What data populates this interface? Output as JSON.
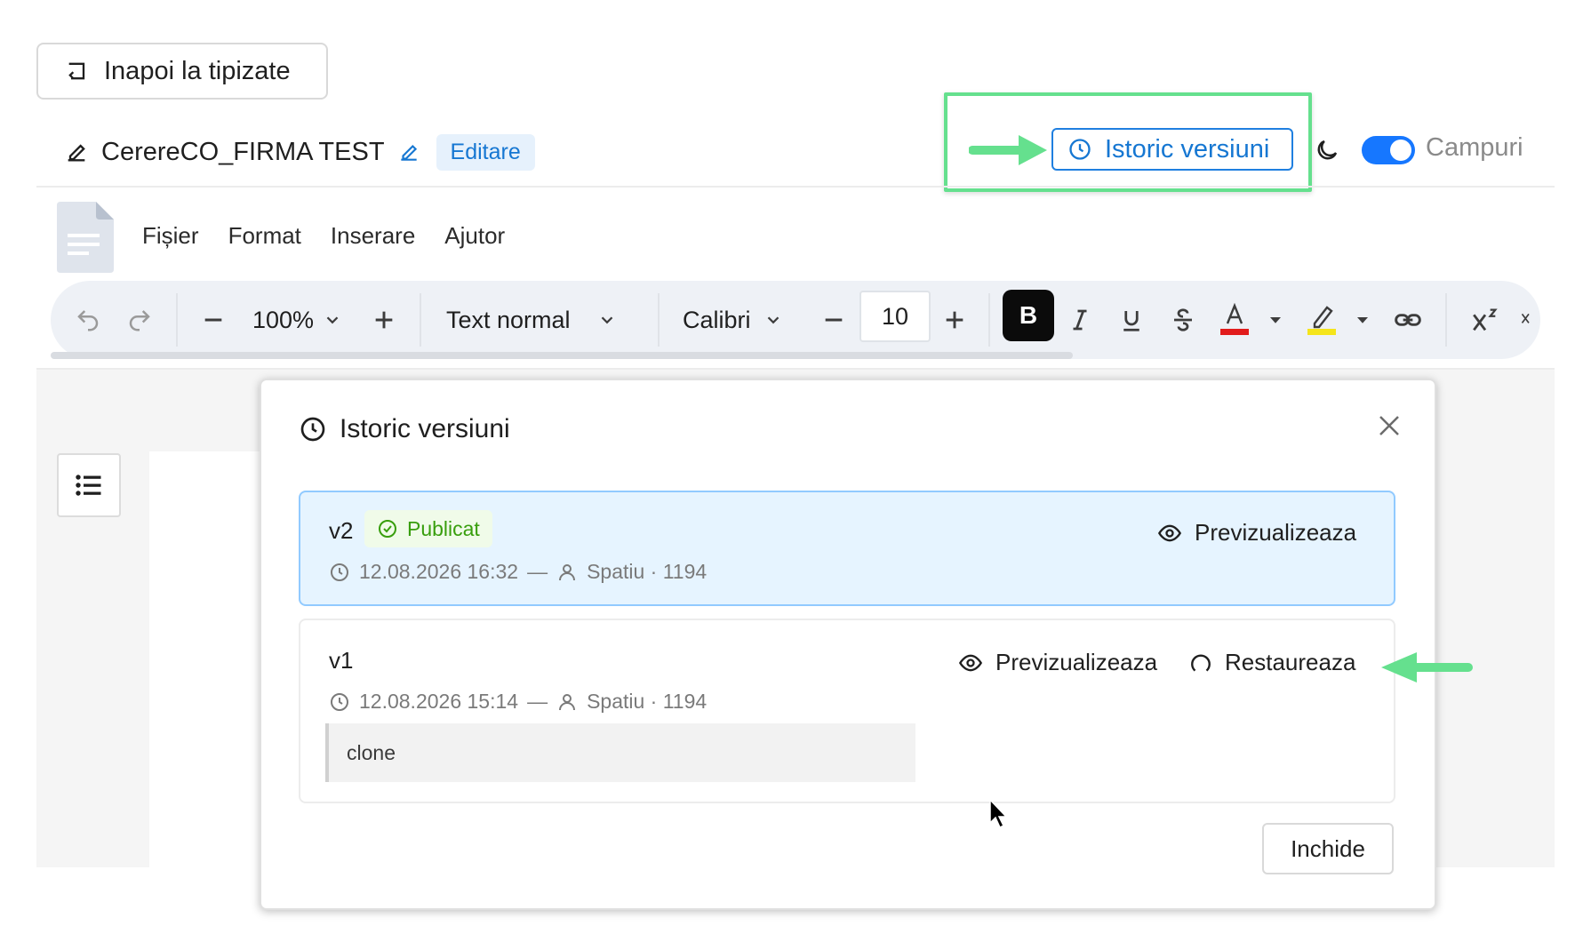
{
  "header": {
    "back_label": "Inapoi la tipizate",
    "doc_title": "CerereCO_FIRMA TEST",
    "edit_badge": "Editare",
    "history_label": "Istoric versiuni",
    "fields_label": "Campuri"
  },
  "menu": {
    "items": [
      "Fișier",
      "Format",
      "Inserare",
      "Ajutor"
    ]
  },
  "toolbar": {
    "zoom": "100%",
    "style": "Text normal",
    "font": "Calibri",
    "font_size": "10",
    "bold": "B"
  },
  "modal": {
    "title": "Istoric versiuni",
    "versions": [
      {
        "label": "v2",
        "status": "Publicat",
        "datetime": "12.08.2026 16:32",
        "separator": "—",
        "author": "Spatiu · 1194",
        "preview_label": "Previzualizeaza"
      },
      {
        "label": "v1",
        "datetime": "12.08.2026 15:14",
        "separator": "—",
        "author": "Spatiu · 1194",
        "preview_label": "Previzualizeaza",
        "restore_label": "Restaureaza",
        "note": "clone"
      }
    ],
    "close_label": "Inchide"
  },
  "colors": {
    "accent": "#1677ff",
    "highlight": "#65e08e",
    "published": "#389e0d"
  }
}
